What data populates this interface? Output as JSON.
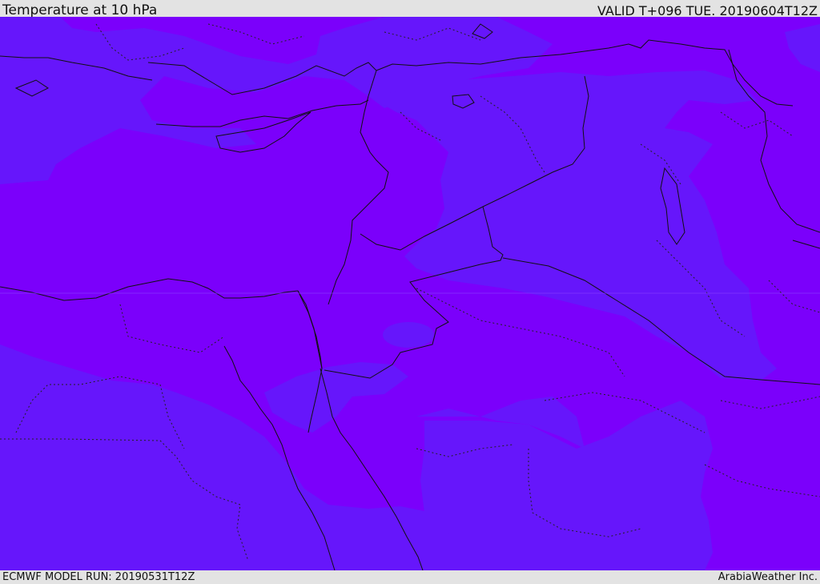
{
  "header": {
    "title": "Temperature at 10 hPa",
    "valid": "VALID T+096 TUE. 20190604T12Z"
  },
  "footer": {
    "model_run": "ECMWF MODEL RUN: 20190531T12Z",
    "credit": "ArabiaWeather Inc."
  },
  "map": {
    "colors": {
      "warm": "#7b00fb",
      "cool": "#6616fb",
      "coast": "#111111",
      "border": "#111111"
    }
  }
}
